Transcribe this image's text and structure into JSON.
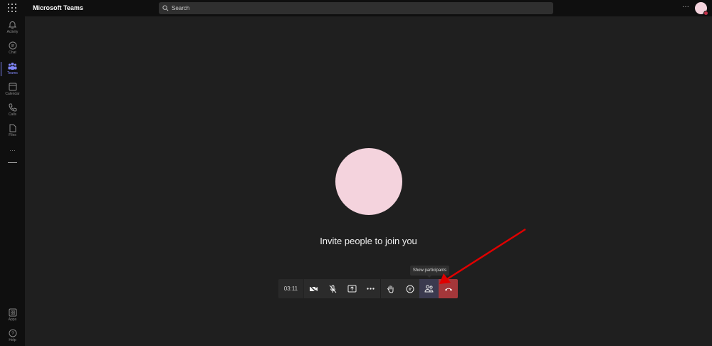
{
  "app": {
    "title": "Microsoft Teams"
  },
  "search": {
    "placeholder": "Search"
  },
  "rail": {
    "items": [
      {
        "label": "Activity"
      },
      {
        "label": "Chat"
      },
      {
        "label": "Teams"
      },
      {
        "label": "Calendar"
      },
      {
        "label": "Calls"
      },
      {
        "label": "Files"
      }
    ],
    "more": "···",
    "apps": "Apps",
    "help": "Help"
  },
  "call": {
    "invite_text": "Invite people to join you",
    "timer": "03:11",
    "tooltip": "Show participants"
  },
  "colors": {
    "accent": "#7f85f5",
    "hangup": "#a4373a",
    "avatar": "#f4d3dd",
    "annotation": "#e00000"
  }
}
